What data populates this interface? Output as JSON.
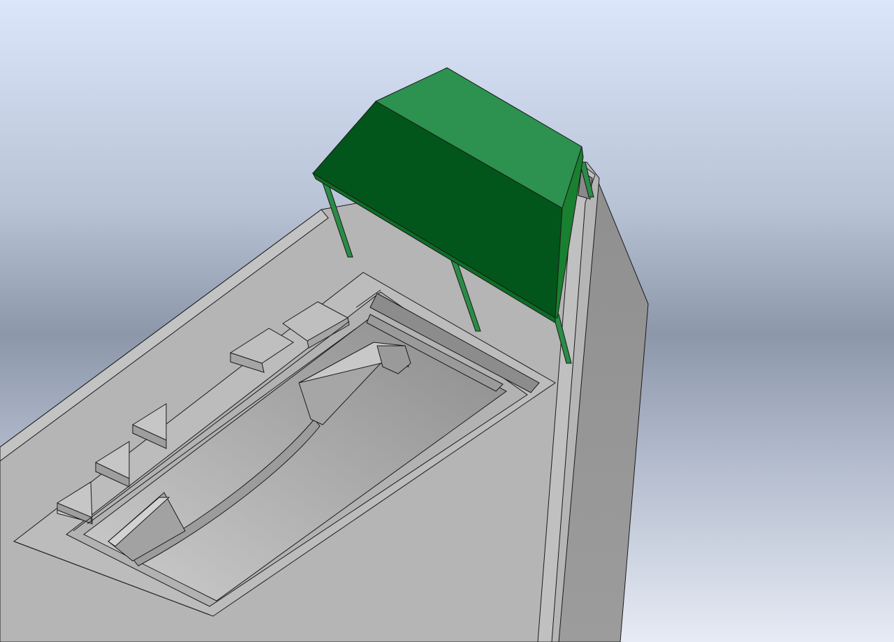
{
  "viewport": {
    "background_top": "#dbe6fb",
    "background_mid": "#8c97aa",
    "background_bottom": "#e6ebf5"
  },
  "model": {
    "body_color": "#b4b4b4",
    "body_light_color": "#c6c6c6",
    "body_dark_color": "#8e8e8e",
    "edge_color": "#1a1a1a",
    "canopy_top_color": "#2d9150",
    "canopy_front_color": "#03561b",
    "canopy_side_color": "#18802f",
    "canopy_post_color": "#2a8c46"
  }
}
